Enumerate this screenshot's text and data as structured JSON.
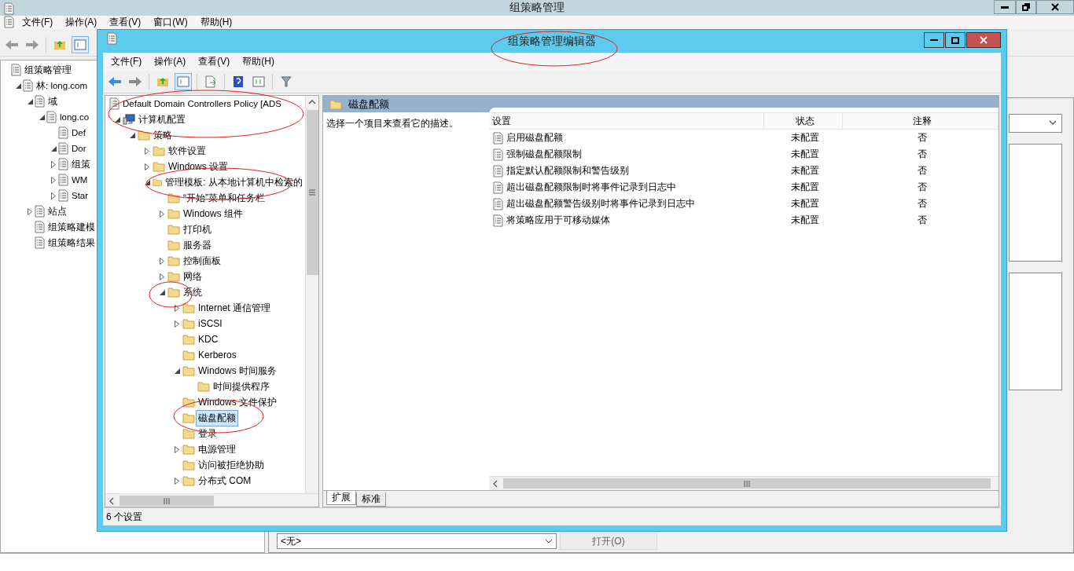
{
  "background_window": {
    "title": "组策略管理",
    "menu": [
      "文件(F)",
      "操作(A)",
      "查看(V)",
      "窗口(W)",
      "帮助(H)"
    ],
    "tree": [
      {
        "label": "组策略管理",
        "children": [
          {
            "label": "林: long.com",
            "expanded": true,
            "children": [
              {
                "label": "域",
                "expanded": true,
                "children": [
                  {
                    "label": "long.co",
                    "expanded": true,
                    "children": [
                      {
                        "label": "Def"
                      },
                      {
                        "label": "Dor",
                        "expanded": true
                      },
                      {
                        "label": "组策",
                        "expanded": false
                      },
                      {
                        "label": "WM",
                        "expanded": false
                      },
                      {
                        "label": "Star",
                        "expanded": false
                      }
                    ]
                  }
                ]
              },
              {
                "label": "站点",
                "expanded": false
              },
              {
                "label": "组策略建模"
              },
              {
                "label": "组策略结果"
              }
            ]
          }
        ]
      }
    ],
    "filter_select": {
      "value": "<无>"
    },
    "open_button": "打开(O)"
  },
  "editor_window": {
    "title": "组策略管理编辑器",
    "menu": [
      "文件(F)",
      "操作(A)",
      "查看(V)",
      "帮助(H)"
    ],
    "tree_root": "Default Domain Controllers Policy [ADS",
    "tree": [
      {
        "label": "计算机配置",
        "expanded": true,
        "selected": false,
        "children": [
          {
            "label": "策略",
            "expanded": true,
            "selected": false,
            "children": [
              {
                "label": "软件设置",
                "expanded": false,
                "selected": false
              },
              {
                "label": "Windows 设置",
                "expanded": false,
                "selected": false
              },
              {
                "label": "管理模板: 从本地计算机中检索的",
                "expanded": true,
                "selected": false,
                "children": [
                  {
                    "label": "“开始”菜单和任务栏",
                    "selected": false
                  },
                  {
                    "label": "Windows 组件",
                    "expanded": false,
                    "selected": false
                  },
                  {
                    "label": "打印机",
                    "selected": false
                  },
                  {
                    "label": "服务器",
                    "selected": false
                  },
                  {
                    "label": "控制面板",
                    "expanded": false,
                    "selected": false
                  },
                  {
                    "label": "网络",
                    "expanded": false,
                    "selected": false
                  },
                  {
                    "label": "系统",
                    "expanded": true,
                    "selected": false,
                    "children": [
                      {
                        "label": "Internet 通信管理",
                        "expanded": false,
                        "selected": false
                      },
                      {
                        "label": "iSCSI",
                        "expanded": false,
                        "selected": false
                      },
                      {
                        "label": "KDC",
                        "selected": false
                      },
                      {
                        "label": "Kerberos",
                        "selected": false
                      },
                      {
                        "label": "Windows 时间服务",
                        "expanded": true,
                        "selected": false,
                        "children": [
                          {
                            "label": "时间提供程序",
                            "selected": false
                          }
                        ]
                      },
                      {
                        "label": "Windows 文件保护",
                        "selected": false
                      },
                      {
                        "label": "磁盘配额",
                        "selected": true
                      },
                      {
                        "label": "登录",
                        "selected": false
                      },
                      {
                        "label": "电源管理",
                        "expanded": false,
                        "selected": false
                      },
                      {
                        "label": "访问被拒绝协助",
                        "selected": false
                      },
                      {
                        "label": "分布式 COM",
                        "expanded": false,
                        "selected": false
                      }
                    ]
                  }
                ]
              }
            ]
          }
        ]
      }
    ],
    "panel_title": "磁盘配额",
    "description": "选择一个项目来查看它的描述。",
    "table": {
      "columns": [
        "设置",
        "状态",
        "注释"
      ],
      "rows": [
        [
          "启用磁盘配额",
          "未配置",
          "否"
        ],
        [
          "强制磁盘配额限制",
          "未配置",
          "否"
        ],
        [
          "指定默认配额限制和警告级别",
          "未配置",
          "否"
        ],
        [
          "超出磁盘配额限制时将事件记录到日志中",
          "未配置",
          "否"
        ],
        [
          "超出磁盘配额警告级别时将事件记录到日志中",
          "未配置",
          "否"
        ],
        [
          "将策略应用于可移动媒体",
          "未配置",
          "否"
        ]
      ]
    },
    "view_tabs": [
      {
        "label": "扩展",
        "selected": true
      },
      {
        "label": "标准",
        "selected": false
      }
    ],
    "status_bar": "6 个设置"
  }
}
